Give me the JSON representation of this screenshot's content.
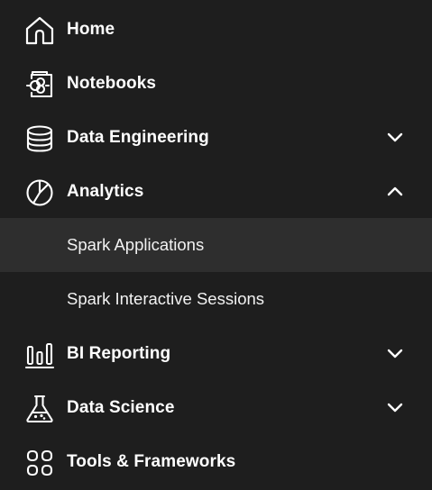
{
  "nav": {
    "home": {
      "label": "Home",
      "icon": "home-icon"
    },
    "notebooks": {
      "label": "Notebooks",
      "icon": "notebook-icon"
    },
    "data_engineering": {
      "label": "Data Engineering",
      "icon": "database-icon",
      "expanded": false
    },
    "analytics": {
      "label": "Analytics",
      "icon": "pie-chart-icon",
      "expanded": true,
      "children": [
        {
          "label": "Spark Applications",
          "active": true
        },
        {
          "label": "Spark Interactive Sessions",
          "active": false
        }
      ]
    },
    "bi_reporting": {
      "label": "BI Reporting",
      "icon": "bar-chart-icon",
      "expanded": false
    },
    "data_science": {
      "label": "Data Science",
      "icon": "flask-icon",
      "expanded": false
    },
    "tools_frameworks": {
      "label": "Tools & Frameworks",
      "icon": "grid-icon"
    }
  },
  "colors": {
    "background": "#1e1e1e",
    "active_background": "#2e2e2e",
    "text": "#ffffff"
  }
}
